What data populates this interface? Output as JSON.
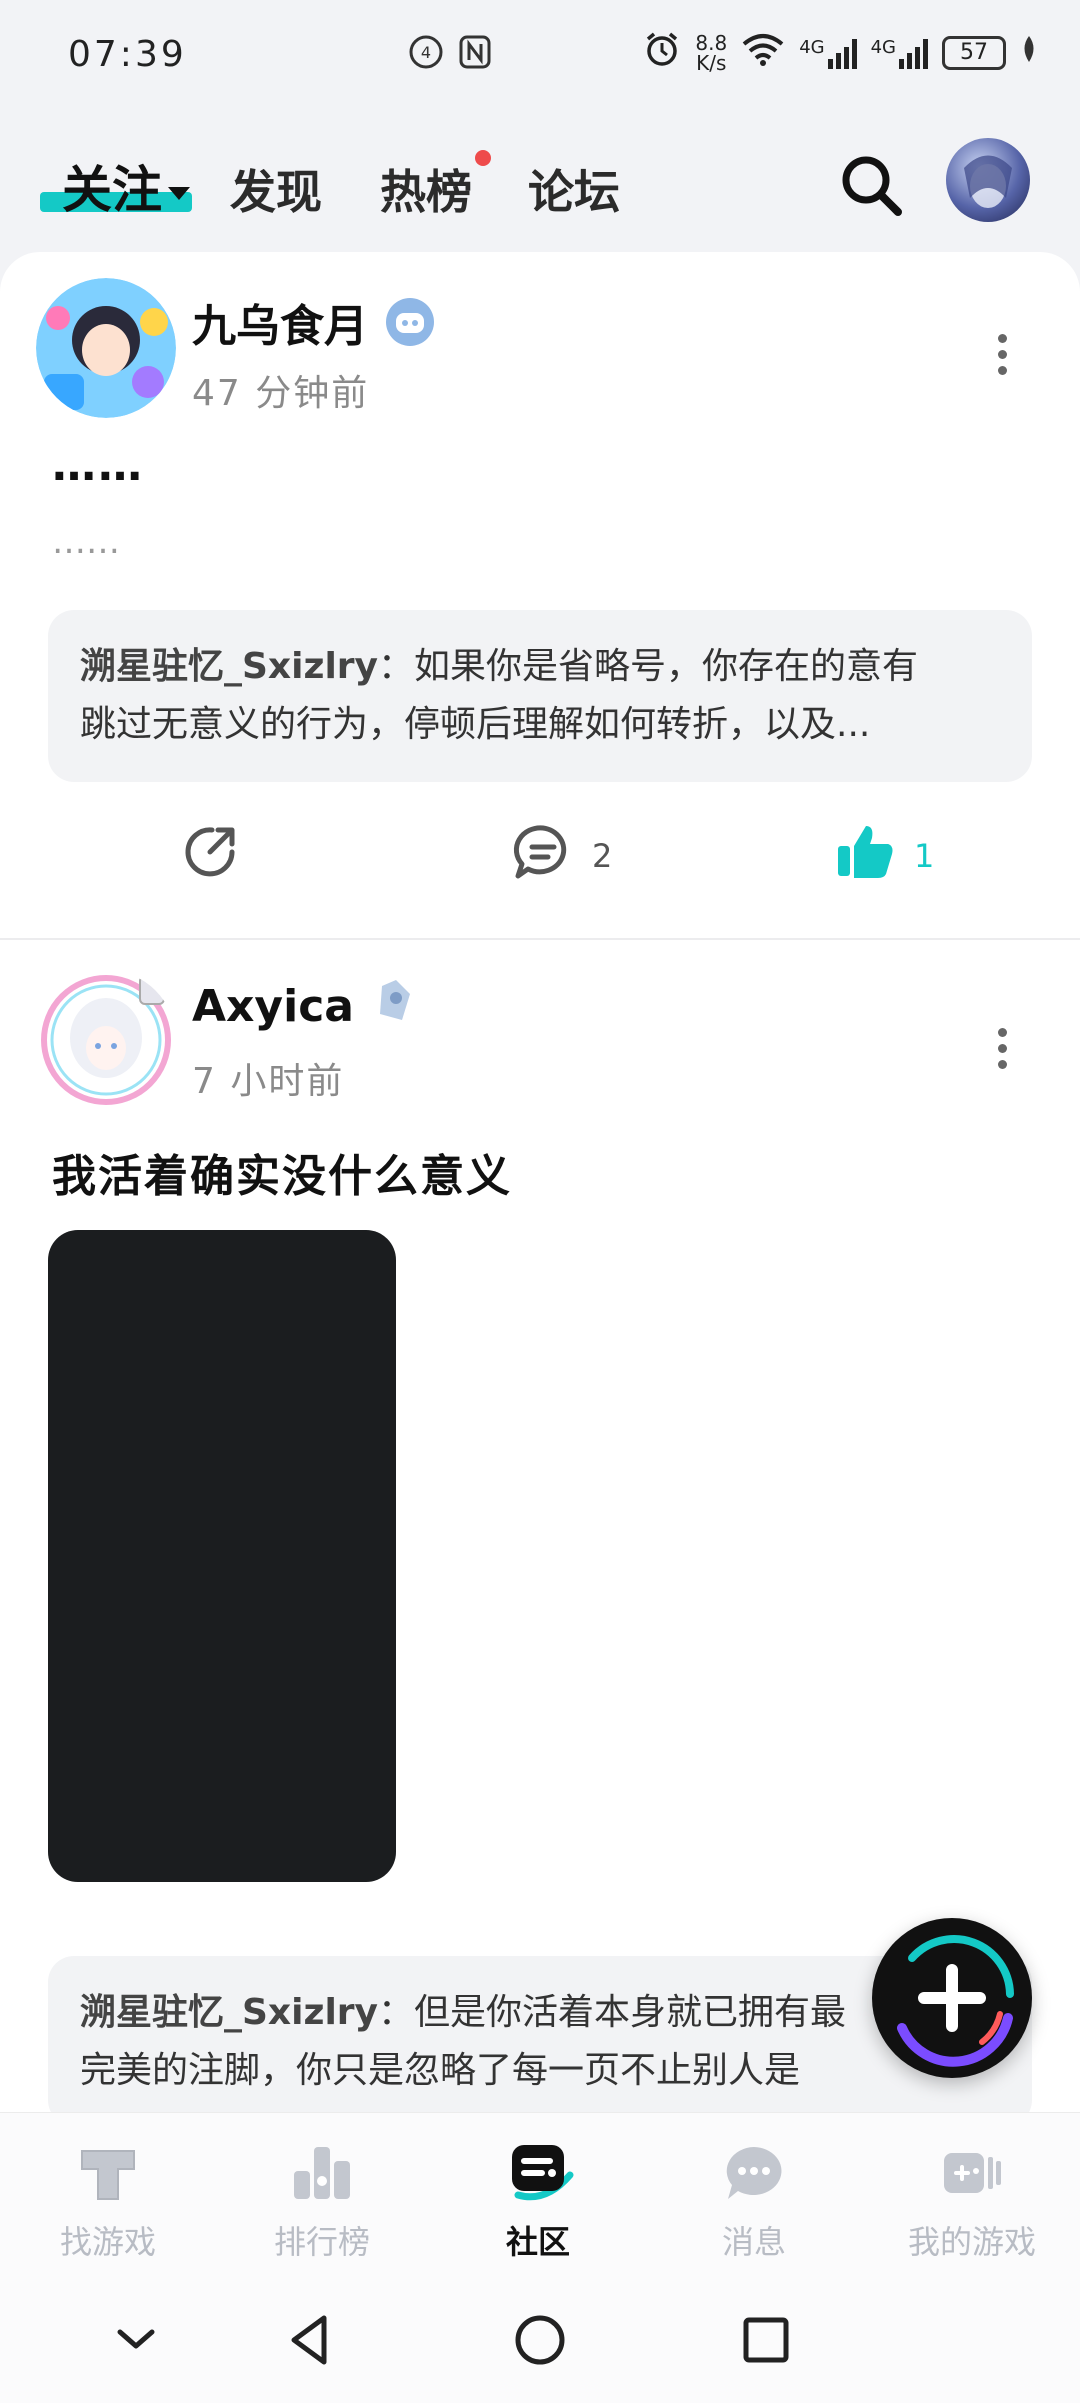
{
  "status_bar": {
    "time": "07:39",
    "speed": "8.8",
    "speed_unit": "K/s",
    "network_1": "4G",
    "network_2": "4G",
    "battery": "57"
  },
  "top_tabs": [
    {
      "label": "关注",
      "active": true
    },
    {
      "label": "发现"
    },
    {
      "label": "热榜",
      "has_dot": true
    },
    {
      "label": "论坛"
    }
  ],
  "posts": [
    {
      "author": "九乌食月",
      "time": "47 分钟前",
      "title": "……",
      "body": "……",
      "comment_user": "溯星驻忆_Sxizlry",
      "comment_line1": "：如果你是省略号，你存在的意有",
      "comment_line2": "跳过无意义的行为，停顿后理解如何转折，以及...",
      "comments": "2",
      "likes": "1"
    },
    {
      "author": "Axyica",
      "time": "7 小时前",
      "title": "我活着确实没什么意义",
      "comment_user": "溯星驻忆_Sxizlry",
      "comment_line1": "：但是你活着本身就已拥有最",
      "comment_line2": "完美的注脚，你只是忽略了每一页不止别人是"
    }
  ],
  "bottom_nav": [
    {
      "label": "找游戏"
    },
    {
      "label": "排行榜"
    },
    {
      "label": "社区",
      "active": true
    },
    {
      "label": "消息"
    },
    {
      "label": "我的游戏"
    }
  ],
  "colors": {
    "accent": "#14c9c6",
    "notification_dot": "#ee4b4b",
    "background": "#f2f3f6"
  },
  "icons": [
    "search-icon",
    "share-icon",
    "comment-icon",
    "like-icon",
    "more-icon",
    "plus-icon",
    "back-icon",
    "home-icon",
    "recents-icon",
    "hide-keyboard-icon"
  ]
}
